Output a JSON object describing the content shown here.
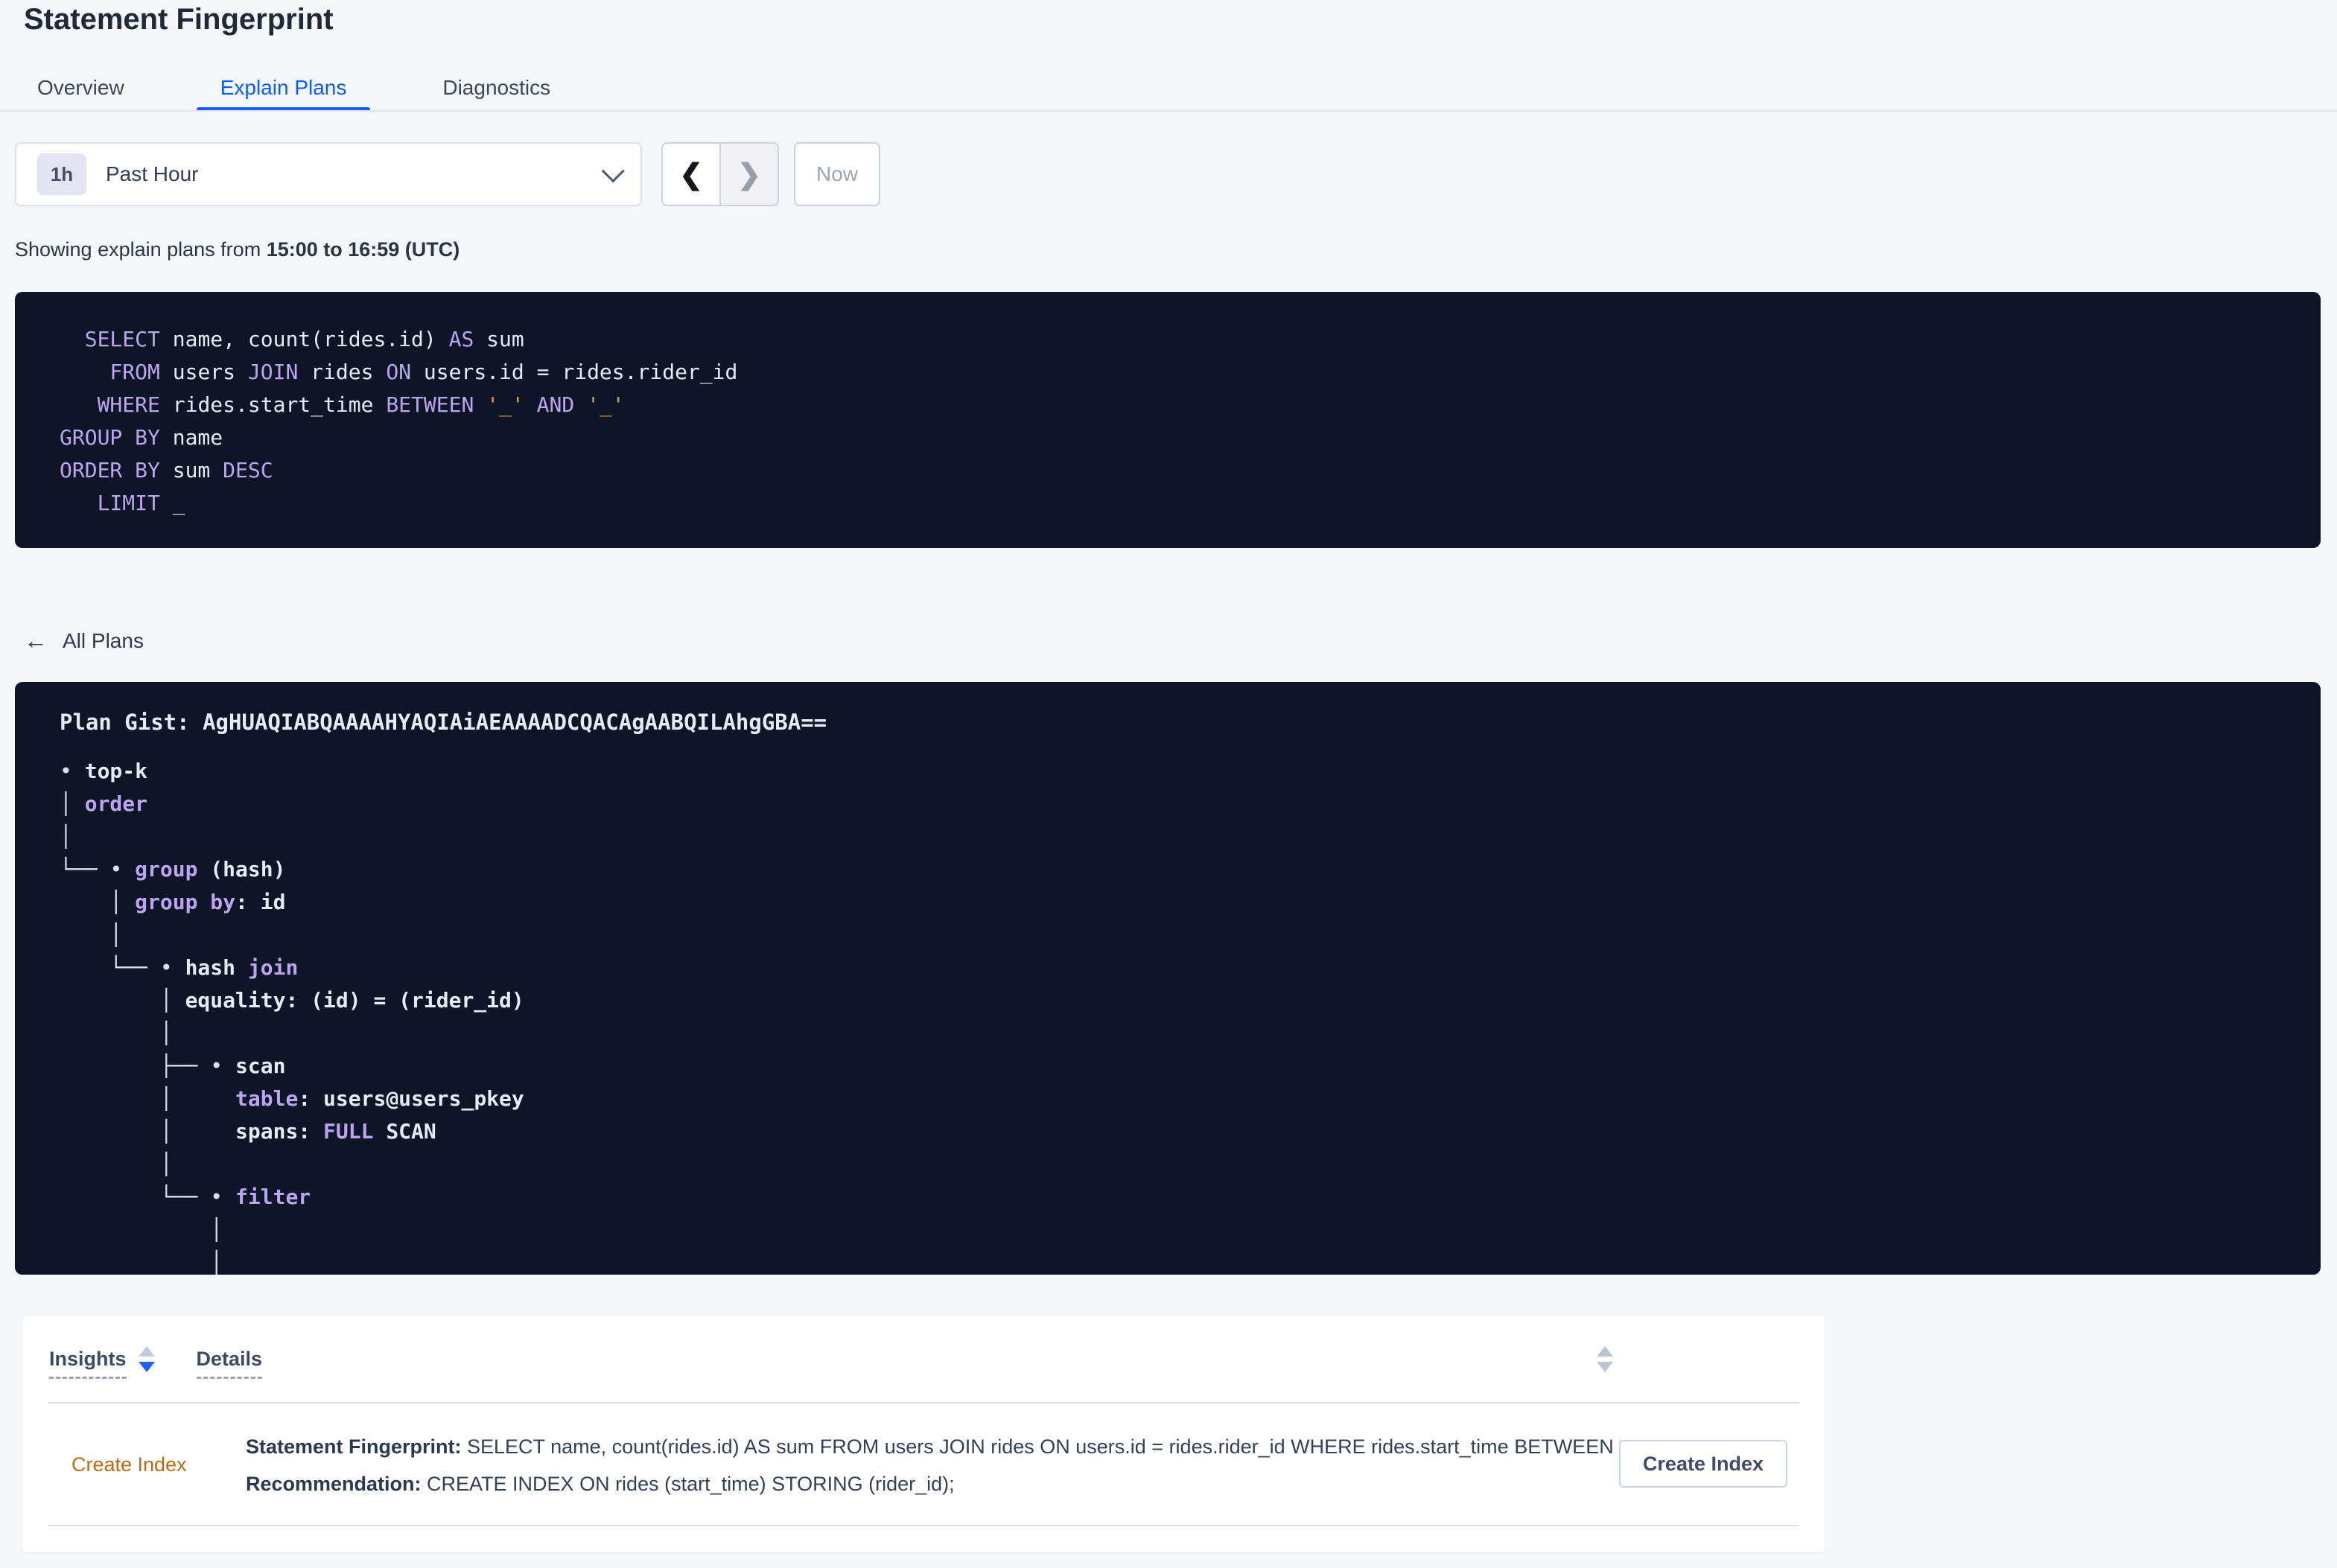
{
  "page": {
    "title": "Statement Fingerprint"
  },
  "tabs": [
    {
      "label": "Overview",
      "active": false
    },
    {
      "label": "Explain Plans",
      "active": true
    },
    {
      "label": "Diagnostics",
      "active": false
    }
  ],
  "time_picker": {
    "badge": "1h",
    "label": "Past Hour",
    "now_label": "Now"
  },
  "icons": {
    "prev": "❮",
    "next": "❯",
    "back_arrow": "←"
  },
  "showing": {
    "prefix": "Showing explain plans from ",
    "range": "15:00 to 16:59 (UTC)"
  },
  "sql": {
    "lines": [
      [
        [
          "  ",
          "w"
        ],
        [
          "SELECT",
          "k"
        ],
        [
          " name, count(rides.id) ",
          "w"
        ],
        [
          "AS",
          "k"
        ],
        [
          " sum",
          "w"
        ]
      ],
      [
        [
          "    ",
          "w"
        ],
        [
          "FROM",
          "k"
        ],
        [
          " users ",
          "w"
        ],
        [
          "JOIN",
          "k"
        ],
        [
          " rides ",
          "w"
        ],
        [
          "ON",
          "k"
        ],
        [
          " users.id = rides.rider_id",
          "w"
        ]
      ],
      [
        [
          "   ",
          "w"
        ],
        [
          "WHERE",
          "k"
        ],
        [
          " rides.start_time ",
          "w"
        ],
        [
          "BETWEEN",
          "k"
        ],
        [
          " ",
          "w"
        ],
        [
          "'_'",
          "o"
        ],
        [
          " ",
          "w"
        ],
        [
          "AND",
          "k"
        ],
        [
          " ",
          "w"
        ],
        [
          "'_'",
          "o"
        ]
      ],
      [
        [
          "GROUP BY",
          "k"
        ],
        [
          " name",
          "w"
        ]
      ],
      [
        [
          "ORDER BY",
          "k"
        ],
        [
          " sum ",
          "w"
        ],
        [
          "DESC",
          "k"
        ]
      ],
      [
        [
          "   ",
          "w"
        ],
        [
          "LIMIT",
          "k"
        ],
        [
          " _",
          "w"
        ]
      ]
    ]
  },
  "all_plans": {
    "label": "All Plans"
  },
  "plan": {
    "gist_label": "Plan Gist: ",
    "gist": "AgHUAQIABQAAAAHYAQIAiAEAAAADCQACAgAABQILAhgGBA==",
    "tree": [
      [
        [
          "• ",
          "p"
        ],
        [
          "top-k",
          "w"
        ]
      ],
      [
        [
          "│ ",
          "p"
        ],
        [
          "order",
          "k"
        ]
      ],
      [
        [
          "│",
          "p"
        ]
      ],
      [
        [
          "└── ",
          "p"
        ],
        [
          "• ",
          "p"
        ],
        [
          "group",
          "k"
        ],
        [
          " (hash)",
          "w"
        ]
      ],
      [
        [
          "    │ ",
          "p"
        ],
        [
          "group by",
          "k"
        ],
        [
          ": id",
          "w"
        ]
      ],
      [
        [
          "    │",
          "p"
        ]
      ],
      [
        [
          "    └── ",
          "p"
        ],
        [
          "• ",
          "p"
        ],
        [
          "hash ",
          "w"
        ],
        [
          "join",
          "k"
        ]
      ],
      [
        [
          "        │ ",
          "p"
        ],
        [
          "equality: (id) = (rider_id)",
          "w"
        ]
      ],
      [
        [
          "        │",
          "p"
        ]
      ],
      [
        [
          "        ├── ",
          "p"
        ],
        [
          "• ",
          "p"
        ],
        [
          "scan",
          "w"
        ]
      ],
      [
        [
          "        │     ",
          "p"
        ],
        [
          "table",
          "k"
        ],
        [
          ": users@users_pkey",
          "w"
        ]
      ],
      [
        [
          "        │     ",
          "p"
        ],
        [
          "spans: ",
          "w"
        ],
        [
          "FULL",
          "k"
        ],
        [
          " SCAN",
          "w"
        ]
      ],
      [
        [
          "        │",
          "p"
        ]
      ],
      [
        [
          "        └── ",
          "p"
        ],
        [
          "• ",
          "p"
        ],
        [
          "filter",
          "k"
        ]
      ],
      [
        [
          "            │",
          "p"
        ]
      ],
      [
        [
          "            │",
          "p"
        ]
      ]
    ]
  },
  "insights_table": {
    "columns": [
      "Insights",
      "Details"
    ],
    "rows": [
      {
        "insight": "Create Index",
        "fingerprint_label": "Statement Fingerprint:",
        "fingerprint": " SELECT name, count(rides.id) AS sum FROM users JOIN rides ON users.id = rides.rider_id WHERE rides.start_time BETWEEN '_…",
        "recommendation_label": "Recommendation:",
        "recommendation": " CREATE INDEX ON rides (start_time) STORING (rider_id);",
        "action": "Create Index"
      }
    ]
  },
  "colors": {
    "page_bg": "#f5f6fa",
    "code_bg": "#0d1527",
    "keyword_purple": "#bda4ef",
    "string_orange": "#e09a40",
    "accent_blue": "#0b5cff",
    "sort_active_blue": "#2161ff",
    "insight_orange": "#c2690f"
  }
}
